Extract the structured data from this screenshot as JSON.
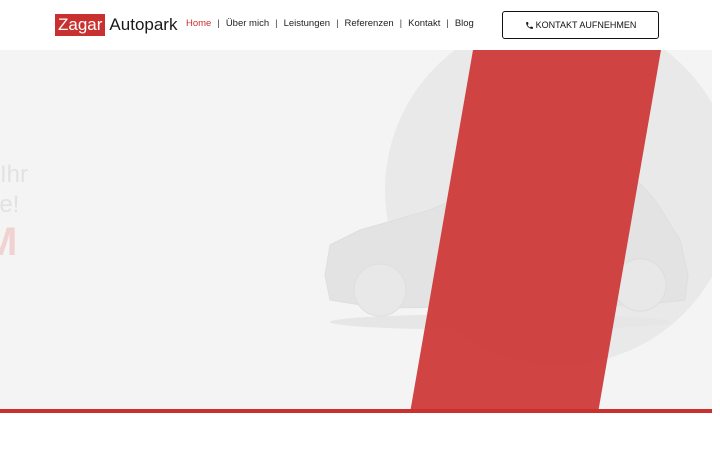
{
  "brand": {
    "logo_box_text": "Zagar",
    "logo_text": "Autopark",
    "accent_color": "#c8312f"
  },
  "nav": {
    "items": [
      {
        "label": "Home",
        "active": true
      },
      {
        "label": "Über mich",
        "active": false
      },
      {
        "label": "Leistungen",
        "active": false
      },
      {
        "label": "Referenzen",
        "active": false
      },
      {
        "label": "Kontakt",
        "active": false
      },
      {
        "label": "Blog",
        "active": false
      }
    ],
    "separator": "|"
  },
  "cta": {
    "label": "KONTAKT AUFNEHMEN",
    "icon": "phone-icon"
  },
  "hero": {
    "line1": "Ihr",
    "line2": "sive!",
    "line3": "M",
    "background_image": "car-silhouette"
  }
}
